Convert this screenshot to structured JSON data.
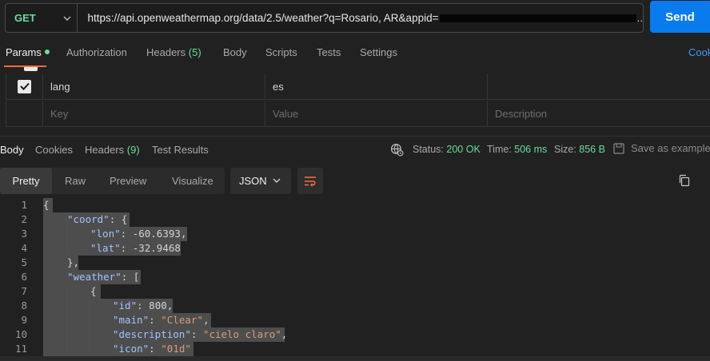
{
  "request": {
    "method": "GET",
    "url_prefix": "https://api.openweathermap.org/data/2.5/weather?q=Rosario, AR&appid=",
    "url_suffix": "..",
    "send_label": "Send"
  },
  "req_tabs": {
    "params": "Params",
    "authorization": "Authorization",
    "headers": "Headers",
    "headers_count": "(5)",
    "body": "Body",
    "scripts": "Scripts",
    "tests": "Tests",
    "settings": "Settings",
    "cookies": "Cook"
  },
  "params_table": {
    "rows": [
      {
        "key": "lang",
        "value": "es",
        "description": ""
      }
    ],
    "placeholder": {
      "key": "Key",
      "value": "Value",
      "description": "Description"
    }
  },
  "response": {
    "tabs": {
      "body": "Body",
      "cookies": "Cookies",
      "headers": "Headers",
      "headers_count": "(9)",
      "test_results": "Test Results"
    },
    "status_label": "Status:",
    "status_value": "200 OK",
    "time_label": "Time:",
    "time_value": "506 ms",
    "size_label": "Size:",
    "size_value": "856 B",
    "save_example": "Save as example"
  },
  "view": {
    "modes": [
      "Pretty",
      "Raw",
      "Preview",
      "Visualize"
    ],
    "format": "JSON"
  },
  "code_lines": [
    {
      "n": "1",
      "text": "{"
    },
    {
      "n": "2",
      "key": "coord",
      "text": ": {"
    },
    {
      "n": "3",
      "key": "lon",
      "text": ": -60.6393,"
    },
    {
      "n": "4",
      "key": "lat",
      "text": ": -32.9468"
    },
    {
      "n": "5",
      "text": "},"
    },
    {
      "n": "6",
      "key": "weather",
      "text": ": ["
    },
    {
      "n": "7",
      "text": "{"
    },
    {
      "n": "8",
      "key": "id",
      "text": ": 800,"
    },
    {
      "n": "9",
      "key": "main",
      "str": "Clear",
      "text": ","
    },
    {
      "n": "10",
      "key": "description",
      "str": "cielo claro",
      "text": ","
    },
    {
      "n": "11",
      "key": "icon",
      "str": "01d",
      "text": ""
    }
  ],
  "colors": {
    "accent": "#ff6c37",
    "send": "#097bed",
    "success": "#6bdd9a"
  }
}
